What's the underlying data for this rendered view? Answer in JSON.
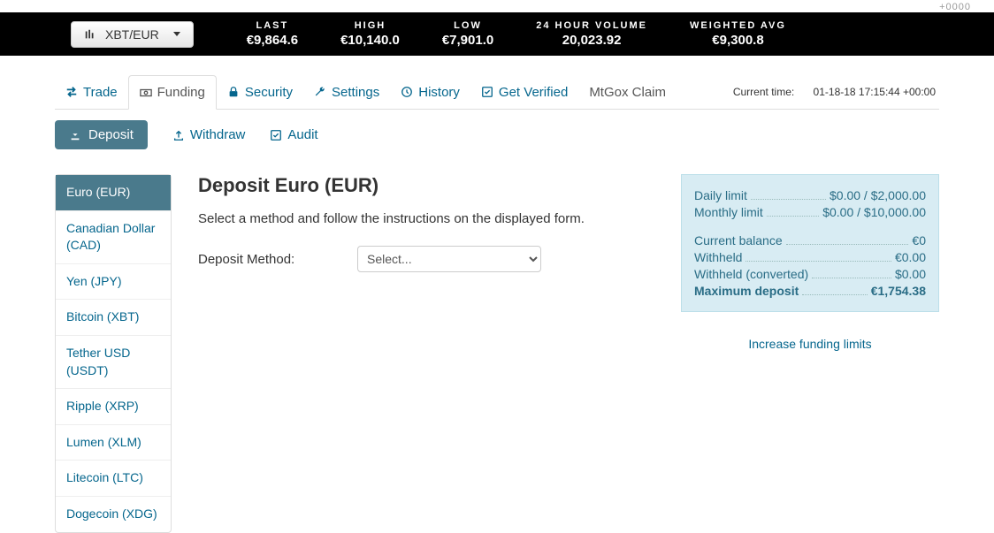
{
  "topcorner": "+0000",
  "pair": "XBT/EUR",
  "stats": [
    {
      "label": "LAST",
      "value": "€9,864.6"
    },
    {
      "label": "HIGH",
      "value": "€10,140.0"
    },
    {
      "label": "LOW",
      "value": "€7,901.0"
    },
    {
      "label": "24 HOUR VOLUME",
      "value": "20,023.92"
    },
    {
      "label": "WEIGHTED AVG",
      "value": "€9,300.8"
    }
  ],
  "tabs": {
    "trade": "Trade",
    "funding": "Funding",
    "security": "Security",
    "settings": "Settings",
    "history": "History",
    "verified": "Get Verified",
    "mtgox": "MtGox Claim"
  },
  "clock": {
    "label": "Current time:",
    "value": "01-18-18 17:15:44 +00:00"
  },
  "subtabs": {
    "deposit": "Deposit",
    "withdraw": "Withdraw",
    "audit": "Audit"
  },
  "sidebar": [
    "Euro (EUR)",
    "Canadian Dollar (CAD)",
    "Yen (JPY)",
    "Bitcoin (XBT)",
    "Tether USD (USDT)",
    "Ripple (XRP)",
    "Lumen (XLM)",
    "Litecoin (LTC)",
    "Dogecoin (XDG)"
  ],
  "heading": "Deposit Euro (EUR)",
  "instructions": "Select a method and follow the instructions on the displayed form.",
  "method_label": "Deposit Method:",
  "method_selected": "Select...",
  "limits": [
    {
      "k": "Daily limit",
      "v": "$0.00 / $2,000.00"
    },
    {
      "k": "Monthly limit",
      "v": "$0.00 / $10,000.00"
    }
  ],
  "balances": [
    {
      "k": "Current balance",
      "v": "€0"
    },
    {
      "k": "Withheld",
      "v": "€0.00"
    },
    {
      "k": "Withheld (converted)",
      "v": "$0.00"
    },
    {
      "k": "Maximum deposit",
      "v": "€1,754.38",
      "bold": true
    }
  ],
  "increase": "Increase funding limits"
}
